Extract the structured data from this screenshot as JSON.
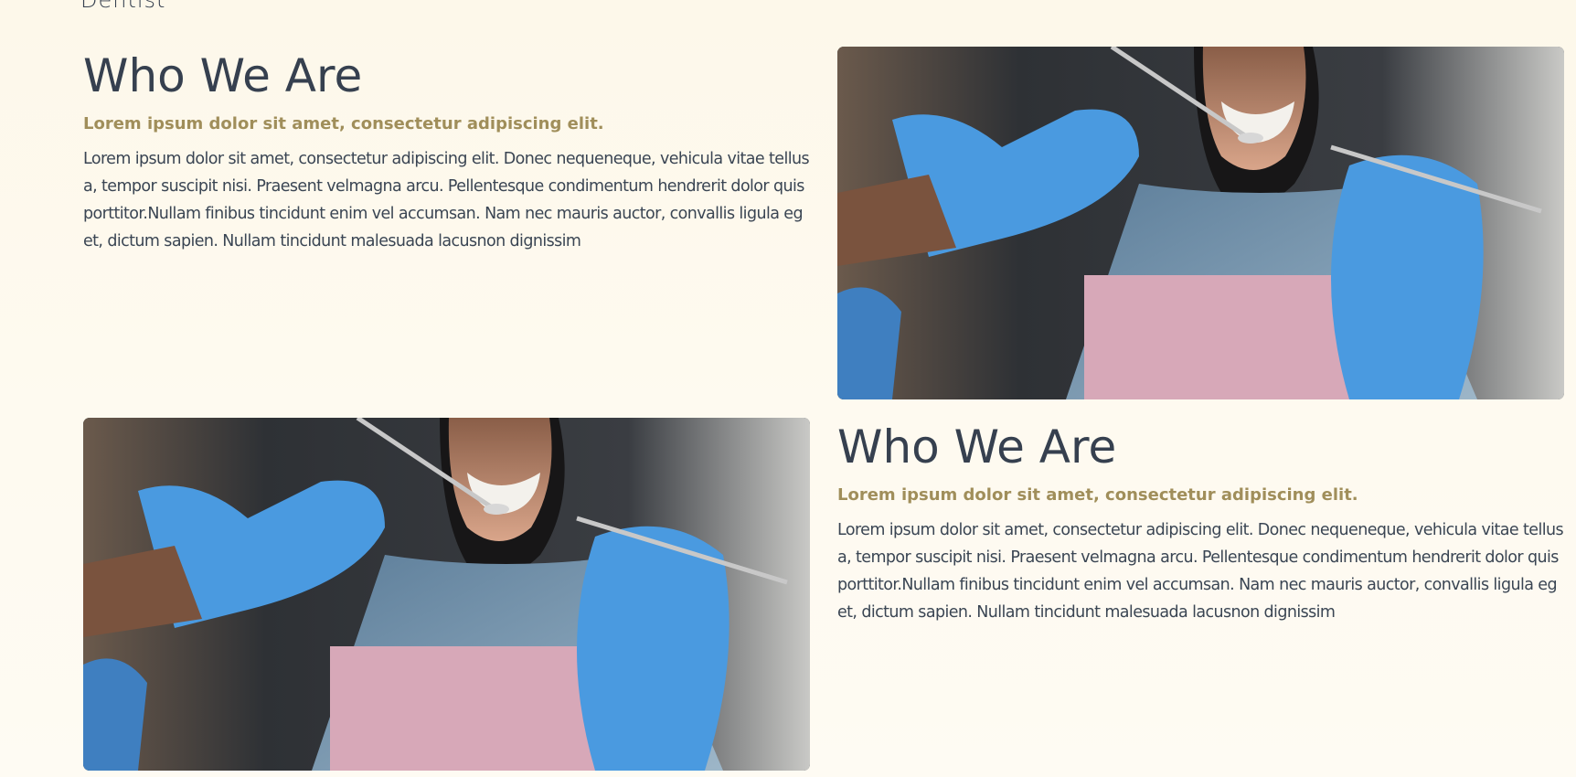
{
  "header": {
    "brand_fragment": "Dentist"
  },
  "sections": [
    {
      "title": "Who We Are",
      "subtitle": "Lorem ipsum dolor sit amet, consectetur adipiscing elit.",
      "body": "Lorem ipsum dolor sit amet, consectetur adipiscing elit. Donec nequeneque, vehicula vitae tellus a, tempor suscipit nisi. Praesent velmagna arcu. Pellentesque condimentum hendrerit dolor quis porttitor.Nullam finibus tincidunt enim vel accumsan. Nam nec mauris auctor, convallis ligula eget, dictum sapien. Nullam tincidunt malesuada lacusnon dignissim"
    },
    {
      "title": "Who We Are",
      "subtitle": "Lorem ipsum dolor sit amet, consectetur adipiscing elit.",
      "body": "Lorem ipsum dolor sit amet, consectetur adipiscing elit. Donec nequeneque, vehicula vitae tellus a, tempor suscipit nisi. Praesent velmagna arcu. Pellentesque condimentum hendrerit dolor quis porttitor.Nullam finibus tincidunt enim vel accumsan. Nam nec mauris auctor, convallis ligula eget, dictum sapien. Nullam tincidunt malesuada lacusnon dignissim"
    }
  ],
  "colors": {
    "background": "#fdf8ea",
    "heading": "#36404f",
    "accent": "#a08e5a",
    "body_text": "#3a4553",
    "glove": "#4a9ae0",
    "bib": "#d7a8b8"
  },
  "icons": {
    "photo": "dental-checkup-photo"
  }
}
